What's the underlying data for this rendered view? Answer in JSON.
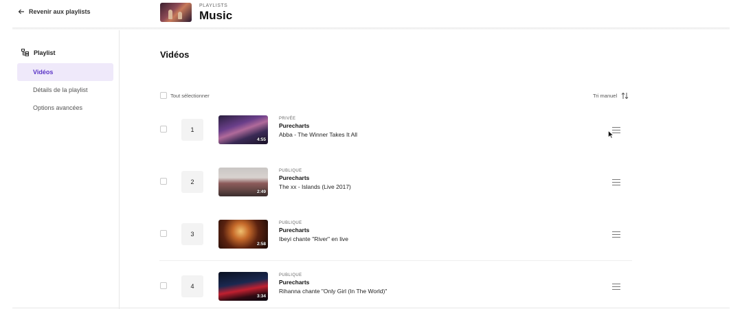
{
  "header": {
    "back_label": "Revenir aux playlists",
    "kicker": "PLAYLISTS",
    "title": "Music"
  },
  "sidebar": {
    "heading": "Playlist",
    "items": [
      {
        "label": "Vidéos",
        "active": true
      },
      {
        "label": "Détails de la playlist",
        "active": false
      },
      {
        "label": "Options avancées",
        "active": false
      }
    ]
  },
  "main": {
    "title": "Vidéos",
    "select_all_label": "Tout sélectionner",
    "sort_label": "Tri manuel"
  },
  "videos": [
    {
      "position": "1",
      "visibility": "PRIVÉE",
      "channel": "Purecharts",
      "title": "Abba - The Winner Takes It All",
      "duration": "4:55"
    },
    {
      "position": "2",
      "visibility": "PUBLIQUE",
      "channel": "Purecharts",
      "title": "The xx - Islands (Live 2017)",
      "duration": "2:49"
    },
    {
      "position": "3",
      "visibility": "PUBLIQUE",
      "channel": "Purecharts",
      "title": "Ibeyi chante \"River\" en live",
      "duration": "2:58"
    },
    {
      "position": "4",
      "visibility": "PUBLIQUE",
      "channel": "Purecharts",
      "title": "Rihanna chante \"Only Girl (In The World)\"",
      "duration": "3:34"
    }
  ],
  "colors": {
    "accent": "#5b35c6",
    "active_bg": "#efe9fa"
  }
}
